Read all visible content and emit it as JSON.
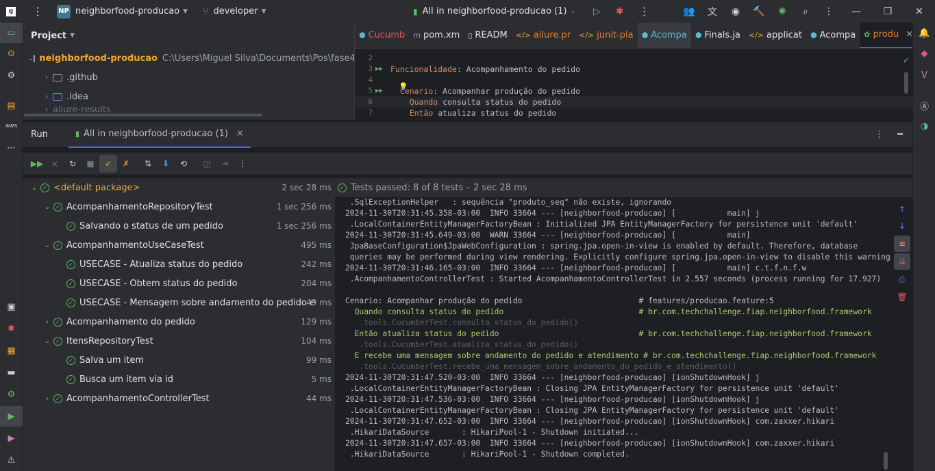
{
  "titlebar": {
    "logo": "IJ",
    "project_badge": "NP",
    "project_name": "neighborfood-producao",
    "branch": "developer",
    "run_config": "All in neighborfood-producao (1)"
  },
  "project_panel": {
    "title": "Project",
    "root_name": "neighborfood-producao",
    "root_path": "C:\\Users\\Miguel Silva\\Documents\\Pos\\fase4\\",
    "items": [
      ".github",
      ".idea",
      "allure-results"
    ]
  },
  "editor": {
    "tabs": [
      "Cucumb",
      "pom.xm",
      "READM",
      "allure.pr",
      "junit-pla",
      "Acompa",
      "Finals.ja",
      "applicat",
      "Acompa",
      "produ"
    ],
    "lines": [
      {
        "num": "2",
        "run": false,
        "parts": [
          {
            "t": "",
            "k": "ct"
          }
        ]
      },
      {
        "num": "3",
        "run": true,
        "parts": [
          {
            "t": "Funcionalidade",
            "k": "kw"
          },
          {
            "t": ": Acompanhamento do pedido",
            "k": "ct"
          }
        ]
      },
      {
        "num": "4",
        "run": false,
        "parts": [
          {
            "t": "",
            "k": "ct"
          }
        ]
      },
      {
        "num": "5",
        "run": true,
        "parts": [
          {
            "t": "  Cenario",
            "k": "kw"
          },
          {
            "t": ": Acompanhar produção do pedido",
            "k": "ct"
          }
        ]
      },
      {
        "num": "6",
        "run": false,
        "parts": [
          {
            "t": "    Quando",
            "k": "kw"
          },
          {
            "t": " consulta status do pedido",
            "k": "ct"
          }
        ]
      },
      {
        "num": "7",
        "run": false,
        "parts": [
          {
            "t": "    Então",
            "k": "kw"
          },
          {
            "t": " atualiza status do pedido",
            "k": "ct"
          }
        ]
      }
    ]
  },
  "run_panel": {
    "title": "Run",
    "tab_label": "All in neighborfood-producao (1)",
    "status": "Tests passed: 8 of 8 tests – 2 sec 28 ms",
    "tree": [
      {
        "name": "<default package>",
        "dur": "2 sec 28 ms",
        "level": 0,
        "expanded": true,
        "pkg": true
      },
      {
        "name": "AcompanhamentoRepositoryTest",
        "dur": "1 sec 256 ms",
        "level": 1,
        "expanded": true
      },
      {
        "name": "Salvando o status de um pedido",
        "dur": "1 sec 256 ms",
        "level": 2
      },
      {
        "name": "AcompanhamentoUseCaseTest",
        "dur": "495 ms",
        "level": 1,
        "expanded": true
      },
      {
        "name": "USECASE - Atualiza status do pedido",
        "dur": "242 ms",
        "level": 2
      },
      {
        "name": "USECASE - Obtem status do pedido",
        "dur": "204 ms",
        "level": 2
      },
      {
        "name": "USECASE - Mensagem sobre andamento do pedido e",
        "dur": "49 ms",
        "level": 2
      },
      {
        "name": "Acompanhamento do pedido",
        "dur": "129 ms",
        "level": 1,
        "expanded": false
      },
      {
        "name": "ItensRepositoryTest",
        "dur": "104 ms",
        "level": 1,
        "expanded": true
      },
      {
        "name": "Salva um item",
        "dur": "99 ms",
        "level": 2
      },
      {
        "name": "Busca um item via id",
        "dur": "5 ms",
        "level": 2
      },
      {
        "name": "AcompanhamentoControllerTest",
        "dur": "44 ms",
        "level": 1,
        "expanded": false
      }
    ],
    "console": [
      {
        "t": " .SqlExceptionHelper   : sequência \"produto_seq\" não existe, ignorando",
        "c": ""
      },
      {
        "t": "2024-11-30T20:31:45.358-03:00  INFO 33664 --- [neighborfood-producao] [           main] j",
        "c": ""
      },
      {
        "t": " .LocalContainerEntityManagerFactoryBean : Initialized JPA EntityManagerFactory for persistence unit 'default'",
        "c": ""
      },
      {
        "t": "2024-11-30T20:31:45.649-03:00  WARN 33664 --- [neighborfood-producao] [           main]",
        "c": ""
      },
      {
        "t": " JpaBaseConfiguration$JpaWebConfiguration : spring.jpa.open-in-view is enabled by default. Therefore, database",
        "c": ""
      },
      {
        "t": " queries may be performed during view rendering. Explicitly configure spring.jpa.open-in-view to disable this warning",
        "c": ""
      },
      {
        "t": "2024-11-30T20:31:46.165-03:00  INFO 33664 --- [neighborfood-producao] [           main] c.t.f.n.f.w",
        "c": ""
      },
      {
        "t": " .AcompanhamentoControllerTest : Started AcompanhamentoControllerTest in 2.557 seconds (process running for 17.927)",
        "c": ""
      },
      {
        "t": "",
        "c": ""
      },
      {
        "t": "Cenario: Acompanhar produção do pedido                         # features/producao.feature:5",
        "c": ""
      },
      {
        "t": "  Quando consulta status do pedido                             # br.com.techchallenge.fiap.neighborfood.framework",
        "c": "g"
      },
      {
        "t": "   .tools.CucumberTest.consulta_status_do_pedido()",
        "c": "dim"
      },
      {
        "t": "  Então atualiza status do pedido                              # br.com.techchallenge.fiap.neighborfood.framework",
        "c": "g"
      },
      {
        "t": "   .tools.CucumberTest.atualiza_status_do_pedido()",
        "c": "dim"
      },
      {
        "t": "  E recebe uma mensagem sobre andamento do pedido e atendimento # br.com.techchallenge.fiap.neighborfood.framework",
        "c": "g"
      },
      {
        "t": "   .tools.CucumberTest.recebe_uma_mensagem_sobre_andamento_do_pedido_e_atendimento()",
        "c": "dim"
      },
      {
        "t": "2024-11-30T20:31:47.520-03:00  INFO 33664 --- [neighborfood-producao] [ionShutdownHook] j",
        "c": ""
      },
      {
        "t": " .LocalContainerEntityManagerFactoryBean : Closing JPA EntityManagerFactory for persistence unit 'default'",
        "c": ""
      },
      {
        "t": "2024-11-30T20:31:47.536-03:00  INFO 33664 --- [neighborfood-producao] [ionShutdownHook] j",
        "c": ""
      },
      {
        "t": " .LocalContainerEntityManagerFactoryBean : Closing JPA EntityManagerFactory for persistence unit 'default'",
        "c": ""
      },
      {
        "t": "2024-11-30T20:31:47.652-03:00  INFO 33664 --- [neighborfood-producao] [ionShutdownHook] com.zaxxer.hikari",
        "c": ""
      },
      {
        "t": " .HikariDataSource       : HikariPool-1 - Shutdown initiated...",
        "c": ""
      },
      {
        "t": "2024-11-30T20:31:47.657-03:00  INFO 33664 --- [neighborfood-producao] [ionShutdownHook] com.zaxxer.hikari",
        "c": ""
      },
      {
        "t": " .HikariDataSource       : HikariPool-1 - Shutdown completed.",
        "c": ""
      }
    ]
  },
  "colors": {
    "accent": "#3574f0",
    "pass": "#5fb865",
    "keyword": "#cf8e6d",
    "cucumber_step": "#a9c970"
  }
}
